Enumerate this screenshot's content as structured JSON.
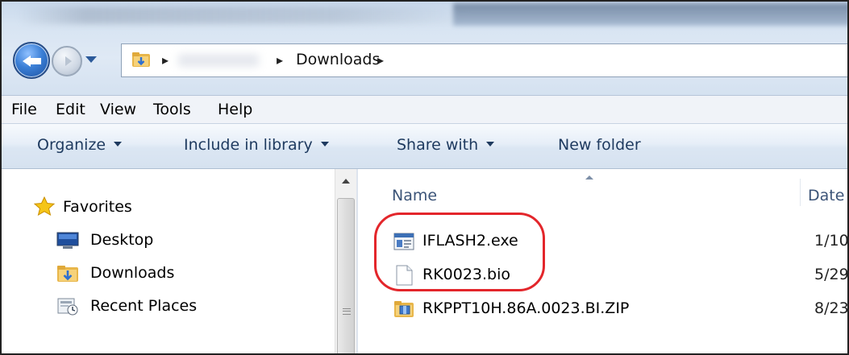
{
  "address_bar": {
    "current_folder": "Downloads"
  },
  "menu": {
    "items": [
      "File",
      "Edit",
      "View",
      "Tools",
      "Help"
    ]
  },
  "command_bar": {
    "organize": "Organize",
    "include_in_library": "Include in library",
    "share_with": "Share with",
    "new_folder": "New folder"
  },
  "nav_pane": {
    "favorites": "Favorites",
    "items": [
      "Desktop",
      "Downloads",
      "Recent Places"
    ]
  },
  "file_list": {
    "columns": {
      "name": "Name",
      "date": "Date"
    },
    "files": [
      {
        "name": "IFLASH2.exe",
        "date": "1/10",
        "icon": "exe-icon"
      },
      {
        "name": "RK0023.bio",
        "date": "5/29",
        "icon": "file-icon"
      },
      {
        "name": "RKPPT10H.86A.0023.BI.ZIP",
        "date": "8/23",
        "icon": "zip-icon"
      }
    ]
  },
  "colors": {
    "highlight": "#e3262b",
    "accent": "#1e3a5f"
  }
}
